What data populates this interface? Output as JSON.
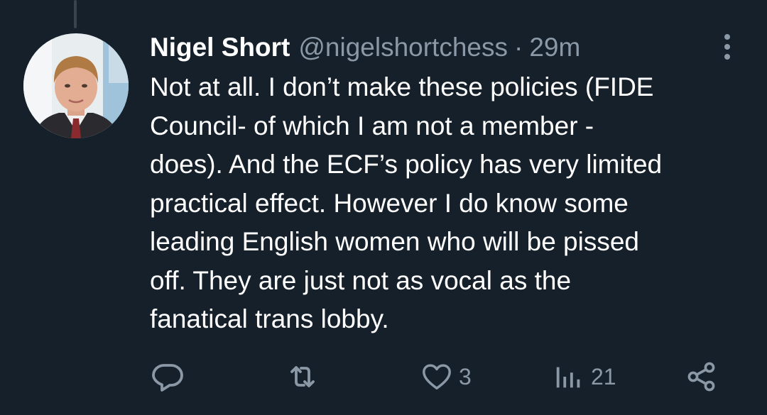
{
  "tweet": {
    "author": {
      "display_name": "Nigel Short",
      "handle": "@nigelshortchess"
    },
    "separator": "·",
    "time": "29m",
    "text_lines": [
      "Not at all. I don’t make these policies (FIDE",
      "Council- of which I am not a member -",
      "does). And the ECF’s policy has very limited",
      "practical effect. However I do know some",
      "leading English women who will be pissed",
      "off. They are just not as vocal as the",
      "fanatical trans lobby."
    ]
  },
  "actions": {
    "reply": {
      "icon": "reply-icon",
      "count": ""
    },
    "retweet": {
      "icon": "retweet-icon",
      "count": ""
    },
    "like": {
      "icon": "heart-icon",
      "count": "3"
    },
    "views": {
      "icon": "views-icon",
      "count": "21"
    },
    "share": {
      "icon": "share-icon"
    }
  },
  "colors": {
    "background": "#15202b",
    "primary_text": "#ffffff",
    "secondary_text": "#8b98a5",
    "thread_line": "#38444d"
  }
}
